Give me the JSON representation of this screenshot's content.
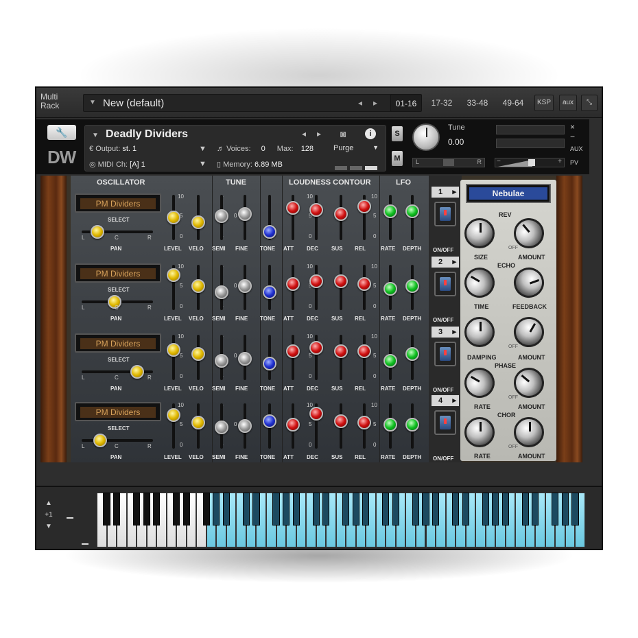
{
  "rack": {
    "label_line1": "Multi",
    "label_line2": "Rack",
    "preset": "New (default)",
    "tabs": [
      "01-16",
      "17-32",
      "33-48",
      "49-64"
    ],
    "ksp": "KSP",
    "aux": "aux"
  },
  "instrument": {
    "name": "Deadly Dividers",
    "logo": "DW",
    "output_label": "Output:",
    "output_value": "st. 1",
    "voices_label": "Voices:",
    "voices_value": "0",
    "max_label": "Max:",
    "max_value": "128",
    "midi_label": "MIDI Ch:",
    "midi_value": "[A] 1",
    "memory_label": "Memory:",
    "memory_value": "6.89 MB",
    "purge": "Purge",
    "solo": "S",
    "mute": "M",
    "tune_label": "Tune",
    "tune_value": "0.00",
    "pan_l": "L",
    "pan_r": "R",
    "aux_label": "AUX",
    "pv_label": "PV",
    "minus": "−",
    "plus": "+",
    "close": "×"
  },
  "sections": {
    "oscillator": "OSCILLATOR",
    "tune": "TUNE",
    "loudness": "LOUDNESS CONTOUR",
    "lfo": "LFO"
  },
  "labels": {
    "select": "SELECT",
    "pan": "PAN",
    "level": "LEVEL",
    "velo": "VELO",
    "semi": "SEMI",
    "fine": "FINE",
    "tone": "TONE",
    "att": "ATT",
    "dec": "DEC",
    "sus": "SUS",
    "rel": "REL",
    "rate": "RATE",
    "depth": "DEPTH",
    "onoff": "ON/OFF",
    "l": "L",
    "c": "C",
    "r": "R",
    "s10": "10",
    "s5": "5",
    "s0": "0",
    "plus": "+",
    "minus": "−"
  },
  "voices": [
    {
      "num": "1",
      "osc": "PM Dividers",
      "pan": 0.15,
      "level": 0.5,
      "velo": 0.35,
      "semi": 0.55,
      "fine": 0.6,
      "tone": 0.05,
      "att": 0.8,
      "dec": 0.75,
      "sus": 0.6,
      "rel": 0.85,
      "rate": 0.7,
      "depth": 0.7
    },
    {
      "num": "2",
      "osc": "PM Dividers",
      "pan": 0.45,
      "level": 0.9,
      "velo": 0.55,
      "semi": 0.35,
      "fine": 0.55,
      "tone": 0.35,
      "att": 0.6,
      "dec": 0.7,
      "sus": 0.7,
      "rel": 0.6,
      "rate": 0.45,
      "depth": 0.55
    },
    {
      "num": "3",
      "osc": "PM Dividers",
      "pan": 0.85,
      "level": 0.75,
      "velo": 0.6,
      "semi": 0.4,
      "fine": 0.45,
      "tone": 0.3,
      "att": 0.7,
      "dec": 0.8,
      "sus": 0.7,
      "rel": 0.7,
      "rate": 0.4,
      "depth": 0.6
    },
    {
      "num": "4",
      "osc": "PM Dividers",
      "pan": 0.2,
      "level": 0.85,
      "velo": 0.6,
      "semi": 0.45,
      "fine": 0.5,
      "tone": 0.65,
      "att": 0.55,
      "dec": 0.9,
      "sus": 0.65,
      "rel": 0.6,
      "rate": 0.55,
      "depth": 0.55
    }
  ],
  "fx": {
    "preset": "Nebulae",
    "rev": "REV",
    "size": "SIZE",
    "amount": "AMOUNT",
    "echo": "ECHO",
    "time": "TIME",
    "feedback": "FEEDBACK",
    "damping": "DAMPING",
    "phase": "PHASE",
    "rate": "RATE",
    "chor": "CHOR",
    "off": "OFF"
  },
  "keyboard": {
    "up": "▲",
    "octave": "+1",
    "down": "▼"
  }
}
